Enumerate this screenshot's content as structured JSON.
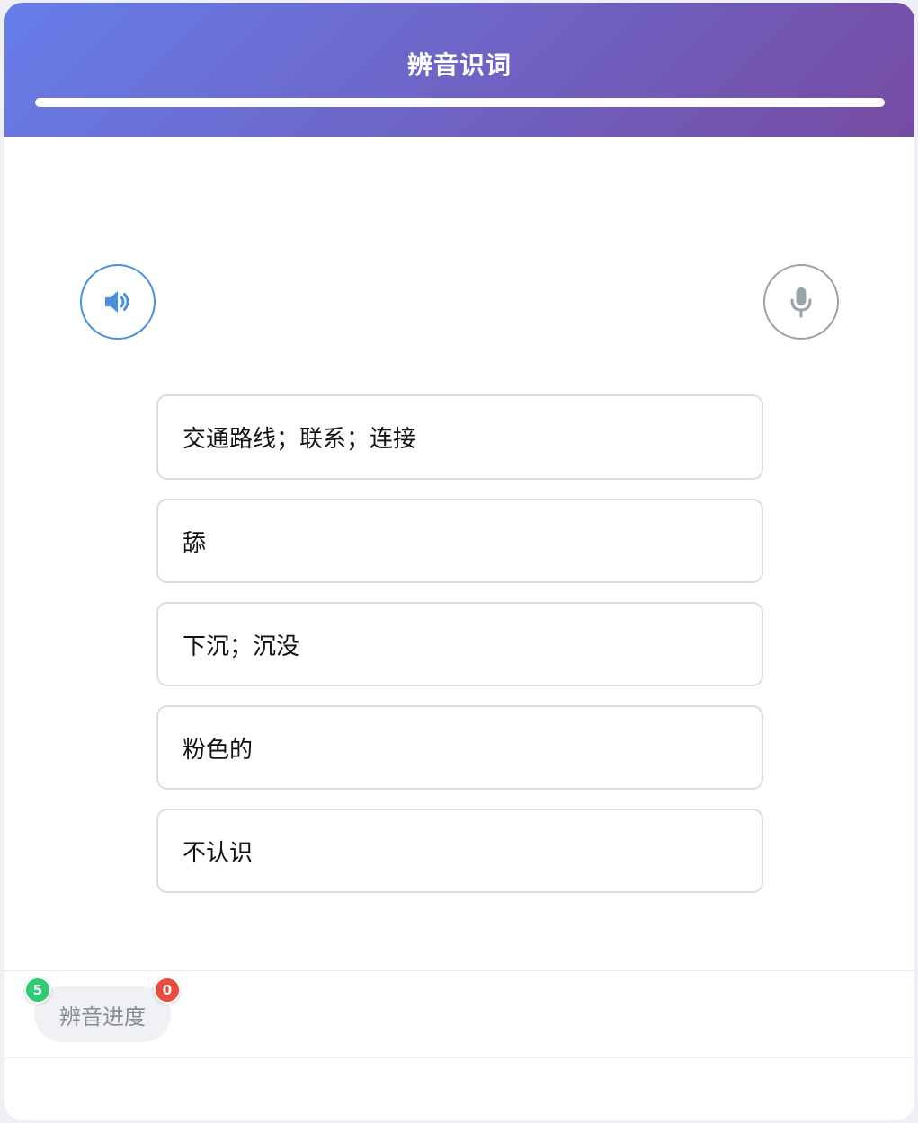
{
  "header": {
    "title": "辨音识词",
    "progress": 1.0
  },
  "controls": {
    "speaker_icon": "speaker-icon",
    "mic_icon": "microphone-icon"
  },
  "options": [
    {
      "label": "交通路线；联系；连接"
    },
    {
      "label": "舔"
    },
    {
      "label": "下沉；沉没"
    },
    {
      "label": "粉色的"
    },
    {
      "label": "不认识"
    }
  ],
  "footer": {
    "progress_label": "辨音进度",
    "correct_count": "5",
    "wrong_count": "0"
  },
  "colors": {
    "gradient_start": "#667eea",
    "gradient_end": "#764ba2",
    "speaker_accent": "#4a90e2",
    "mic_accent": "#95a5a6",
    "correct_badge": "#2ecc71",
    "wrong_badge": "#e74c3c"
  }
}
